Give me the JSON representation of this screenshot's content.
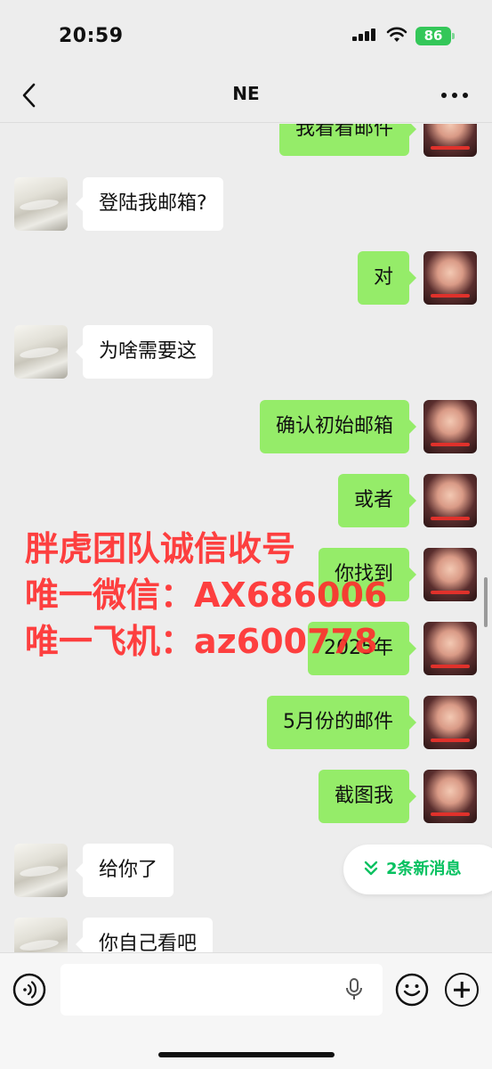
{
  "status_bar": {
    "time": "20:59",
    "battery": "86"
  },
  "header": {
    "title": "NE"
  },
  "messages": [
    {
      "side": "right",
      "text": "我看看邮件"
    },
    {
      "side": "left",
      "text": "登陆我邮箱?"
    },
    {
      "side": "right",
      "text": "对"
    },
    {
      "side": "left",
      "text": "为啥需要这"
    },
    {
      "side": "right",
      "text": "确认初始邮箱"
    },
    {
      "side": "right",
      "text": "或者"
    },
    {
      "side": "right",
      "text": "你找到"
    },
    {
      "side": "right",
      "text": "2025年"
    },
    {
      "side": "right",
      "text": "5月份的邮件"
    },
    {
      "side": "right",
      "text": "截图我"
    },
    {
      "side": "left",
      "text": "给你了"
    },
    {
      "side": "left",
      "text": "你自己看吧"
    }
  ],
  "watermark": {
    "line1": "胖虎团队诚信收号",
    "line2": "唯一微信：AX686006",
    "line3": "唯一飞机：az600778"
  },
  "new_messages": {
    "label": "2条新消息"
  },
  "colors": {
    "bubble_right": "#95ec69",
    "bubble_left": "#ffffff",
    "accent": "#07c160",
    "battery": "#34c759",
    "watermark": "#ff2d2d"
  },
  "icons": [
    "back-icon",
    "more-icon",
    "voice-icon",
    "mic-icon",
    "emoji-icon",
    "plus-icon",
    "chevron-double-down-icon"
  ]
}
